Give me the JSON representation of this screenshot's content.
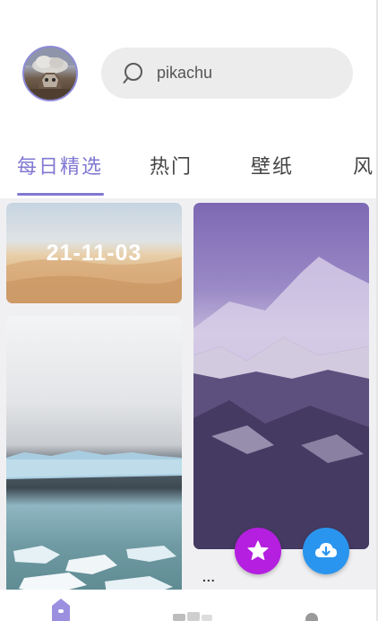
{
  "search": {
    "value": "pikachu",
    "icon": "search-icon"
  },
  "tabs": [
    {
      "label": "每日精选",
      "active": true
    },
    {
      "label": "热门",
      "active": false
    },
    {
      "label": "壁纸",
      "active": false
    },
    {
      "label": "风",
      "active": false
    }
  ],
  "feed": {
    "desert_date": "21-11-03",
    "more": "..."
  },
  "colors": {
    "accent": "#8078d2",
    "favorite_fab": "#b41fe0",
    "download_fab": "#2a95ee"
  },
  "icons": {
    "favorite": "star-icon",
    "download": "cloud-download-icon",
    "nav_home": "home-icon",
    "nav_gallery": "gallery-icon",
    "nav_profile": "profile-icon"
  }
}
